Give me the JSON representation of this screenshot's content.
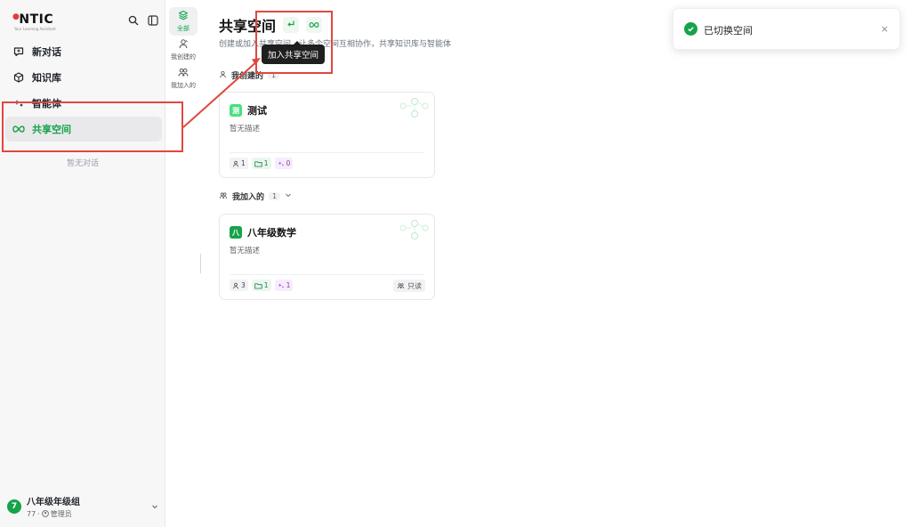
{
  "app": {
    "logo_text": "NTIC",
    "logo_subtitle": "Your Learning Assistant"
  },
  "sidebar": {
    "items": [
      {
        "label": "新对话",
        "icon": "new-chat-icon"
      },
      {
        "label": "知识库",
        "icon": "knowledge-base-icon"
      },
      {
        "label": "智能体",
        "icon": "agent-icon"
      },
      {
        "label": "共享空间",
        "icon": "shared-space-icon",
        "active": true
      }
    ],
    "empty_conversations": "暂无对话",
    "user": {
      "avatar_letter": "7",
      "name": "八年级年级组",
      "id": "77",
      "role": "管理员"
    }
  },
  "filters": [
    {
      "label": "全部",
      "icon": "layers-icon",
      "active": true
    },
    {
      "label": "我创建的",
      "icon": "user-icon"
    },
    {
      "label": "我加入的",
      "icon": "users-icon"
    }
  ],
  "main": {
    "title": "共享空间",
    "subtitle": "创建或加入共享空间，让多个空间互相协作，共享知识库与智能体",
    "tooltip": "加入共享空间",
    "sections": [
      {
        "title": "我创建的",
        "count": "1",
        "cards": [
          {
            "badge": "测",
            "title": "测试",
            "desc": "暂无描述",
            "members": "1",
            "kbs": "1",
            "agents": "0",
            "badge_color": "#4ade80"
          }
        ]
      },
      {
        "title": "我加入的",
        "count": "1",
        "cards": [
          {
            "badge": "八",
            "title": "八年级数学",
            "desc": "暂无描述",
            "members": "3",
            "kbs": "1",
            "agents": "1",
            "readonly": "只读",
            "badge_color": "#16a34a"
          }
        ]
      }
    ]
  },
  "toast": {
    "message": "已切换空间",
    "close": "×"
  },
  "colors": {
    "accent": "#16a34a",
    "annotation": "#e0483f"
  }
}
